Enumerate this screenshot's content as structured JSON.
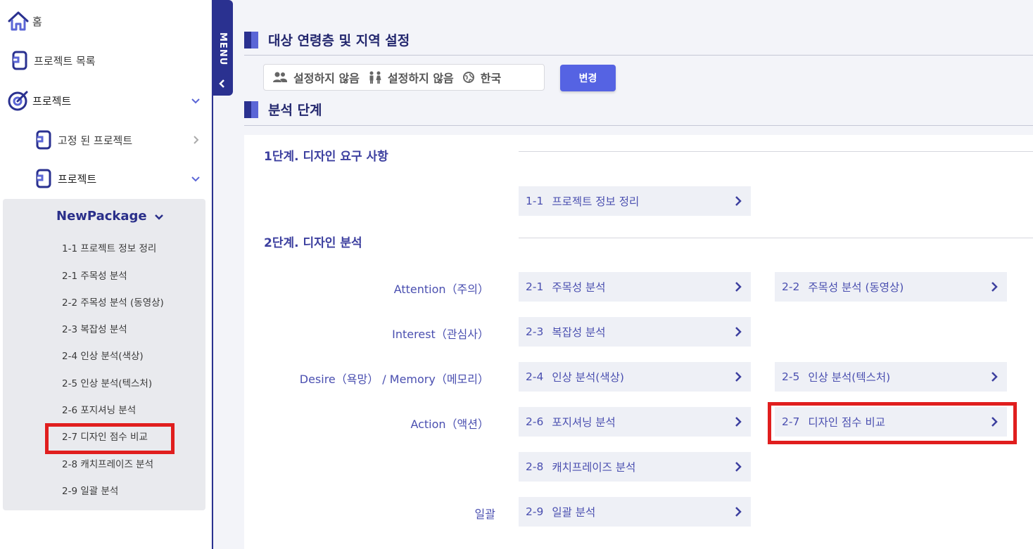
{
  "sidebar": {
    "home": "홈",
    "project_list": "프로젝트 목록",
    "project": "프로젝트",
    "pinned_projects": "고정 된 프로젝트",
    "project_sub": "프로젝트",
    "package": {
      "name": "NewPackage",
      "items": [
        "1-1 프로젝트 정보 정리",
        "2-1 주목성 분석",
        "2-2 주목성 분석 (동영상)",
        "2-3 복잡성 분석",
        "2-4 인상 분석(색상)",
        "2-5 인상 분석(텍스처)",
        "2-6 포지셔닝 분석",
        "2-7 디자인 점수 비교",
        "2-8 캐치프레이즈 분석",
        "2-9 일괄 분석"
      ]
    }
  },
  "menu_toggle": {
    "label": "MENU"
  },
  "target_section": {
    "title": "대상 연령층 및 지역 설정",
    "age": "설정하지 않음",
    "gender": "설정하지 않음",
    "region": "한국",
    "change_button": "변경"
  },
  "analysis_section": {
    "title": "분석 단계",
    "stage1": {
      "title": "1단계. 디자인 요구 사항",
      "steps": [
        {
          "code": "1-1",
          "label": "프로젝트 정보 정리"
        }
      ]
    },
    "stage2": {
      "title": "2단계. 디자인 분석",
      "rows": [
        {
          "label": "Attention（주의）",
          "steps": [
            {
              "code": "2-1",
              "label": "주목성 분석"
            },
            {
              "code": "2-2",
              "label": "주목성 분석 (동영상)"
            }
          ]
        },
        {
          "label": "Interest（관심사）",
          "steps": [
            {
              "code": "2-3",
              "label": "복잡성 분석"
            }
          ]
        },
        {
          "label": "Desire（욕망） / Memory（메모리）",
          "steps": [
            {
              "code": "2-4",
              "label": "인상 분석(색상)"
            },
            {
              "code": "2-5",
              "label": "인상 분석(텍스처)"
            }
          ]
        },
        {
          "label": "Action（액션）",
          "steps": [
            {
              "code": "2-6",
              "label": "포지셔닝 분석"
            },
            {
              "code": "2-7",
              "label": "디자인 점수 비교"
            }
          ]
        },
        {
          "label": "",
          "steps": [
            {
              "code": "2-8",
              "label": "캐치프레이즈 분석"
            }
          ]
        },
        {
          "label": "일괄",
          "steps": [
            {
              "code": "2-9",
              "label": "일괄 분석"
            }
          ]
        }
      ]
    }
  },
  "colors": {
    "accent": "#5563e3",
    "navy": "#2a3190",
    "highlight": "#e01e1e"
  }
}
